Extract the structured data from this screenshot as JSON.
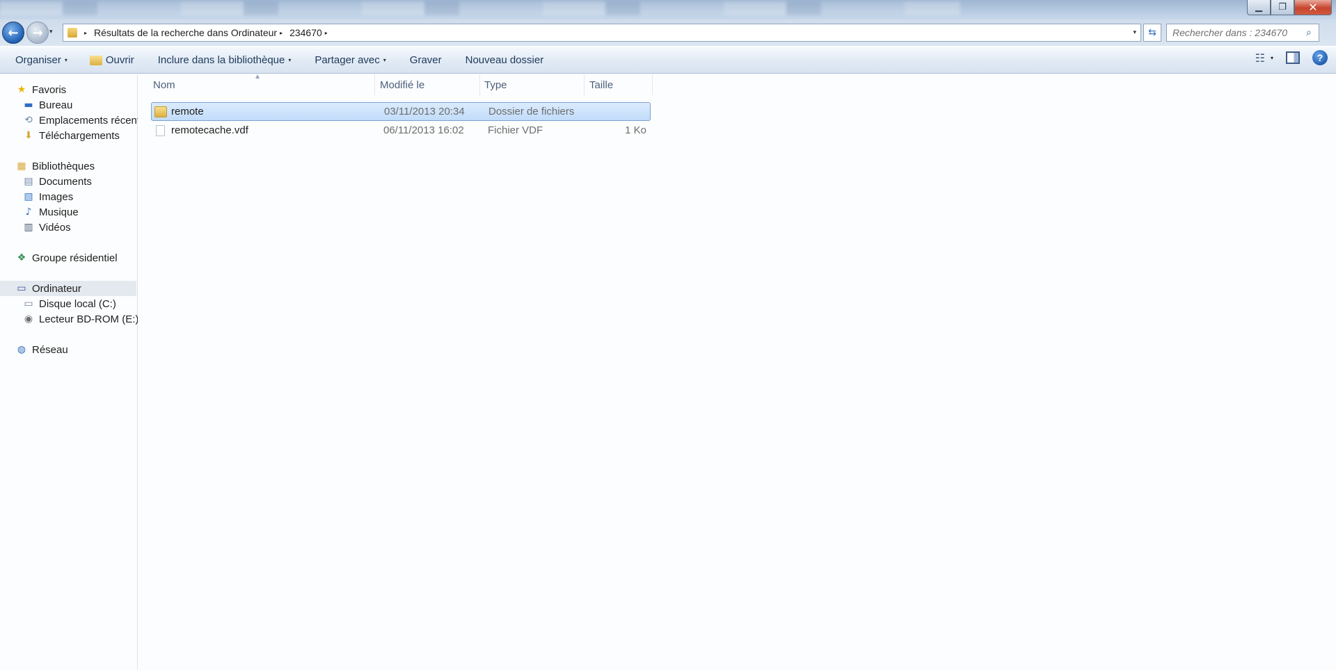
{
  "window": {
    "controls": {
      "minimize": "▁",
      "maximize": "❐",
      "close": "✕"
    }
  },
  "nav": {
    "back_icon": "←",
    "forward_icon": "→",
    "history_dropdown": "▾",
    "breadcrumb": [
      "Résultats de la recherche dans Ordinateur",
      "234670"
    ],
    "crumb_separator": "▸",
    "address_dropdown": "▾",
    "refresh_icon": "⇆",
    "search_placeholder": "Rechercher dans : 234670",
    "search_icon": "⌕"
  },
  "toolbar": {
    "organize": "Organiser",
    "open": "Ouvrir",
    "include_library": "Inclure dans la bibliothèque",
    "share_with": "Partager avec",
    "burn": "Graver",
    "new_folder": "Nouveau dossier",
    "caret": "▾",
    "views_icon": "☷",
    "help_icon": "?"
  },
  "sidebar": {
    "favorites": {
      "label": "Favoris",
      "icon": "★",
      "color": "#e8b400"
    },
    "favorites_items": [
      {
        "label": "Bureau",
        "icon": "▬",
        "color": "#2f6fc1"
      },
      {
        "label": "Emplacements récents",
        "icon": "⟲",
        "color": "#6f86a8"
      },
      {
        "label": "Téléchargements",
        "icon": "⬇",
        "color": "#d9a738"
      }
    ],
    "libraries": {
      "label": "Bibliothèques",
      "icon": "▦",
      "color": "#d9a738"
    },
    "library_items": [
      {
        "label": "Documents",
        "icon": "▤",
        "color": "#6f86a8"
      },
      {
        "label": "Images",
        "icon": "▧",
        "color": "#3d7cc9"
      },
      {
        "label": "Musique",
        "icon": "♪",
        "color": "#2f6fc1"
      },
      {
        "label": "Vidéos",
        "icon": "▥",
        "color": "#4d5f78"
      }
    ],
    "homegroup": {
      "label": "Groupe résidentiel",
      "icon": "❖",
      "color": "#2f8f4f"
    },
    "computer": {
      "label": "Ordinateur",
      "icon": "▭",
      "color": "#2f4f8f"
    },
    "computer_items": [
      {
        "label": "Disque local (C:)",
        "icon": "▭",
        "color": "#6d7f96"
      },
      {
        "label": "Lecteur BD-ROM (E:)",
        "icon": "◉",
        "color": "#6d6d6d"
      }
    ],
    "network": {
      "label": "Réseau",
      "icon": "◍",
      "color": "#2f6fc1"
    }
  },
  "filelist": {
    "columns": [
      "Nom",
      "Modifié le",
      "Type",
      "Taille"
    ],
    "sort_indicator": "▲",
    "rows": [
      {
        "name": "remote",
        "modified": "03/11/2013 20:34",
        "type": "Dossier de fichiers",
        "size": "",
        "kind": "folder"
      },
      {
        "name": "remotecache.vdf",
        "modified": "06/11/2013 16:02",
        "type": "Fichier VDF",
        "size": "1 Ko",
        "kind": "file"
      }
    ]
  }
}
